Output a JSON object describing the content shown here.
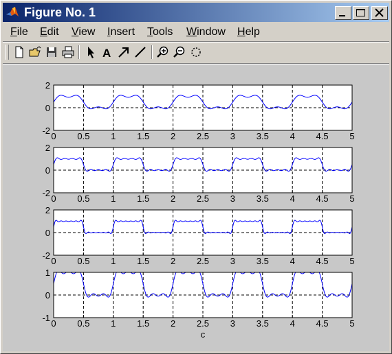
{
  "window": {
    "title": "Figure No. 1",
    "title_gradient": [
      "#0a246a",
      "#a6caf0"
    ]
  },
  "menubar": {
    "items": [
      {
        "underline": "F",
        "rest": "ile"
      },
      {
        "underline": "E",
        "rest": "dit"
      },
      {
        "underline": "V",
        "rest": "iew"
      },
      {
        "underline": "I",
        "rest": "nsert"
      },
      {
        "underline": "T",
        "rest": "ools"
      },
      {
        "underline": "W",
        "rest": "indow"
      },
      {
        "underline": "H",
        "rest": "elp"
      }
    ]
  },
  "toolbar": {
    "icons": [
      "new-file-icon",
      "open-folder-icon",
      "save-icon",
      "print-icon",
      "select-arrow-icon",
      "text-a-icon",
      "arrow-icon",
      "line-icon",
      "zoom-in-icon",
      "zoom-out-icon",
      "rotate-icon"
    ],
    "text_tool_label": "A"
  },
  "chart_data": [
    {
      "type": "line",
      "xlim": [
        0,
        5
      ],
      "ylim": [
        -2,
        2
      ],
      "xticks": [
        "0",
        "0.5",
        "1",
        "1.5",
        "2",
        "2.5",
        "3",
        "3.5",
        "4",
        "4.5",
        "5"
      ],
      "yticks": [
        "2",
        "0",
        "-2"
      ],
      "grid": true,
      "line_color": "#0000ff",
      "period": 1,
      "harmonics": 3
    },
    {
      "type": "line",
      "xlim": [
        0,
        5
      ],
      "ylim": [
        -2,
        2
      ],
      "xticks": [
        "0",
        "0.5",
        "1",
        "1.5",
        "2",
        "2.5",
        "3",
        "3.5",
        "4",
        "4.5",
        "5"
      ],
      "yticks": [
        "2",
        "0",
        "-2"
      ],
      "grid": true,
      "line_color": "#0000ff",
      "period": 1,
      "harmonics": 7
    },
    {
      "type": "line",
      "xlim": [
        0,
        5
      ],
      "ylim": [
        -2,
        2
      ],
      "xticks": [
        "0",
        "0.5",
        "1",
        "1.5",
        "2",
        "2.5",
        "3",
        "3.5",
        "4",
        "4.5",
        "5"
      ],
      "yticks": [
        "2",
        "0",
        "-2"
      ],
      "grid": true,
      "line_color": "#0000ff",
      "period": 1,
      "harmonics": 11
    },
    {
      "type": "line",
      "xlim": [
        0,
        5
      ],
      "ylim": [
        -1,
        1
      ],
      "xticks": [
        "0",
        "0.5",
        "1",
        "1.5",
        "2",
        "2.5",
        "3",
        "3.5",
        "4",
        "4.5",
        "5"
      ],
      "yticks": [
        "1",
        "0",
        "-1"
      ],
      "grid": true,
      "line_color": "#0000ff",
      "period": 1,
      "harmonics": 5,
      "xlabel": "c"
    }
  ]
}
